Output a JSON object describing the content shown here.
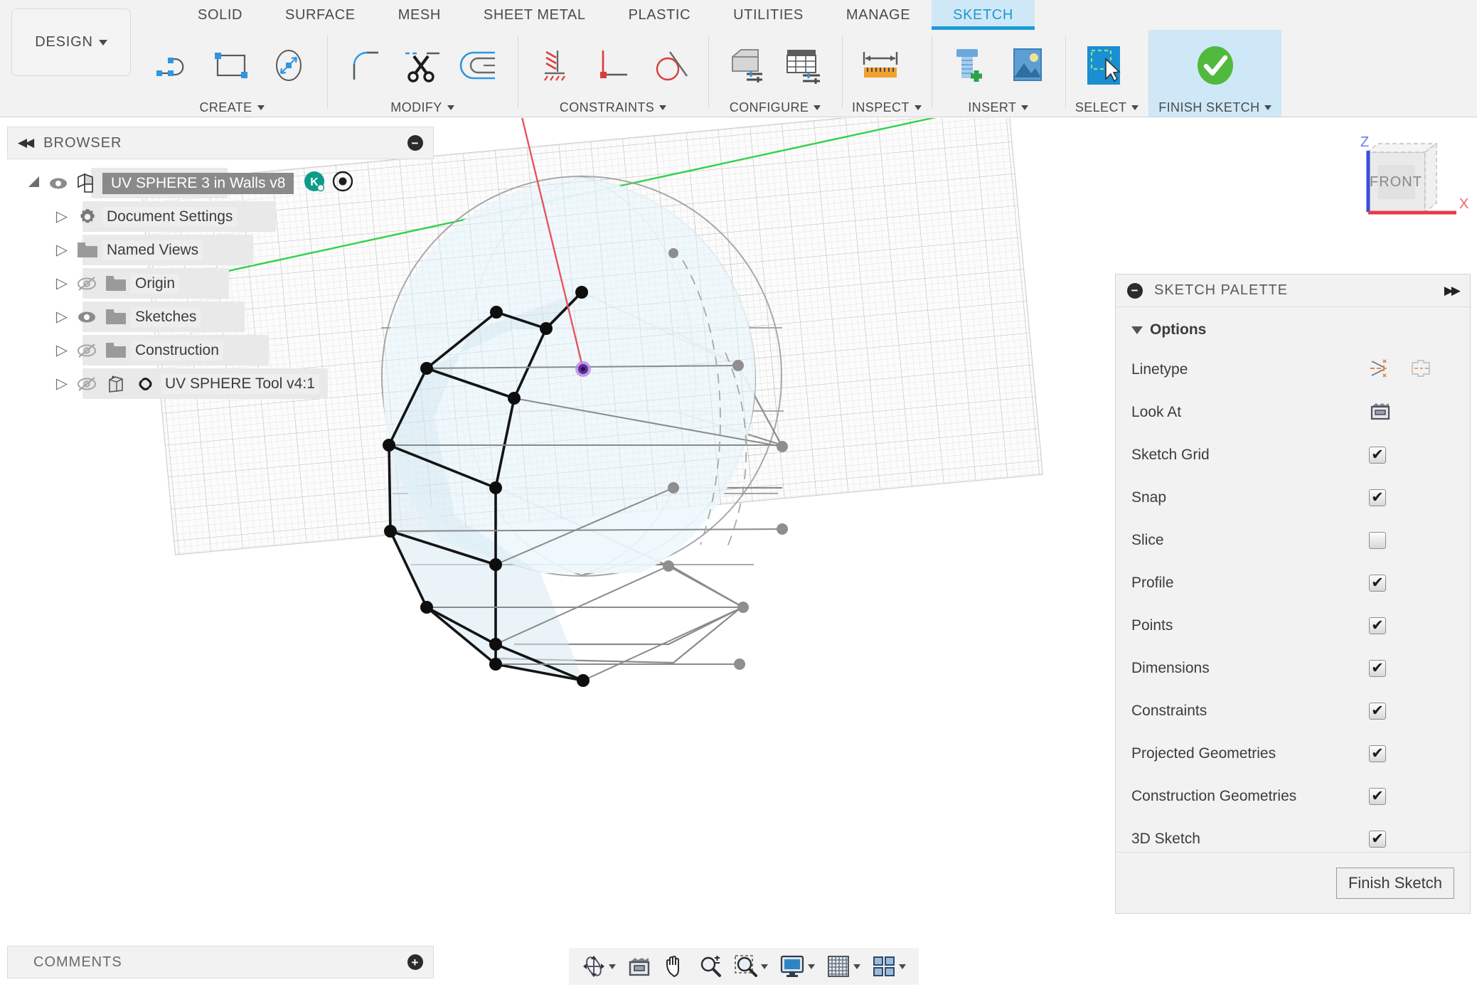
{
  "app": {
    "workspace_button": "DESIGN",
    "tabs": [
      {
        "label": "SOLID",
        "active": false
      },
      {
        "label": "SURFACE",
        "active": false
      },
      {
        "label": "MESH",
        "active": false
      },
      {
        "label": "SHEET METAL",
        "active": false
      },
      {
        "label": "PLASTIC",
        "active": false
      },
      {
        "label": "UTILITIES",
        "active": false
      },
      {
        "label": "MANAGE",
        "active": false
      },
      {
        "label": "SKETCH",
        "active": true
      }
    ],
    "ribbon_panels": [
      {
        "title": "CREATE",
        "has_dropdown": true,
        "icons": [
          "line-arc-icon",
          "rectangle-icon",
          "circle-diameter-icon"
        ]
      },
      {
        "title": "MODIFY",
        "has_dropdown": true,
        "icons": [
          "fillet-icon",
          "trim-scissors-icon",
          "offset-icon"
        ]
      },
      {
        "title": "CONSTRAINTS",
        "has_dropdown": true,
        "icons": [
          "fix-ground-icon",
          "perpendicular-icon",
          "tangent-icon"
        ]
      },
      {
        "title": "CONFIGURE",
        "has_dropdown": true,
        "icons": [
          "configure-part-icon",
          "configure-table-icon"
        ]
      },
      {
        "title": "INSPECT",
        "has_dropdown": true,
        "icons": [
          "measure-ruler-icon"
        ]
      },
      {
        "title": "INSERT",
        "has_dropdown": true,
        "icons": [
          "insert-mcmaster-bolt-icon",
          "insert-canvas-image-icon"
        ]
      },
      {
        "title": "SELECT",
        "has_dropdown": true,
        "icons": [
          "select-window-cursor-icon"
        ]
      },
      {
        "title": "FINISH SKETCH",
        "has_dropdown": true,
        "icons": [
          "green-check-icon"
        ],
        "highlight": true
      }
    ]
  },
  "browser": {
    "title": "BROWSER",
    "collapse_icon": "collapse-left-icon",
    "minimize_icon": "minus-circle-icon",
    "tree": [
      {
        "label": "UV SPHERE 3 in Walls v8",
        "selected": true,
        "indent": 0,
        "arrow": "expanded",
        "eye": "visible",
        "icon": "document-cube-icon",
        "badges": [
          "owner-avatar-K",
          "target-circle-icon"
        ]
      },
      {
        "label": "Document Settings",
        "selected": false,
        "indent": 1,
        "arrow": "collapsed",
        "eye": "none",
        "icon": "gear-icon"
      },
      {
        "label": "Named Views",
        "selected": false,
        "indent": 1,
        "arrow": "collapsed",
        "eye": "none",
        "icon": "folder-icon"
      },
      {
        "label": "Origin",
        "selected": false,
        "indent": 1,
        "arrow": "collapsed",
        "eye": "hidden",
        "icon": "folder-icon"
      },
      {
        "label": "Sketches",
        "selected": false,
        "indent": 1,
        "arrow": "collapsed",
        "eye": "visible",
        "icon": "folder-icon"
      },
      {
        "label": "Construction",
        "selected": false,
        "indent": 1,
        "arrow": "collapsed",
        "eye": "hidden",
        "icon": "folder-icon"
      },
      {
        "label": "UV SPHERE Tool v4:1",
        "selected": false,
        "indent": 1,
        "arrow": "collapsed",
        "eye": "hidden",
        "icon": "component-icon",
        "extra_icon": "link-chain-icon"
      }
    ]
  },
  "comments": {
    "title": "COMMENTS",
    "add_icon": "plus-circle-icon"
  },
  "sketch_palette": {
    "title": "SKETCH PALETTE",
    "minimize_icon": "minus-circle-icon",
    "expand_icon": "double-chevron-right-icon",
    "section": "Options",
    "options": [
      {
        "label": "Linetype",
        "type": "icons",
        "icons": [
          "construction-linetype-icon",
          "centerline-linetype-icon"
        ]
      },
      {
        "label": "Look At",
        "type": "icon",
        "icons": [
          "look-at-camera-icon"
        ]
      },
      {
        "label": "Sketch Grid",
        "type": "checkbox",
        "checked": true
      },
      {
        "label": "Snap",
        "type": "checkbox",
        "checked": true
      },
      {
        "label": "Slice",
        "type": "checkbox",
        "checked": false
      },
      {
        "label": "Profile",
        "type": "checkbox",
        "checked": true
      },
      {
        "label": "Points",
        "type": "checkbox",
        "checked": true
      },
      {
        "label": "Dimensions",
        "type": "checkbox",
        "checked": true
      },
      {
        "label": "Constraints",
        "type": "checkbox",
        "checked": true
      },
      {
        "label": "Projected Geometries",
        "type": "checkbox",
        "checked": true
      },
      {
        "label": "Construction Geometries",
        "type": "checkbox",
        "checked": true
      },
      {
        "label": "3D Sketch",
        "type": "checkbox",
        "checked": true
      }
    ],
    "finish_button": "Finish Sketch"
  },
  "viewcube": {
    "face_label": "FRONT",
    "axis_z": "Z",
    "axis_x": "X",
    "z_color": "#3b4fd8",
    "x_color": "#e8394a"
  },
  "navbar": {
    "items": [
      {
        "name": "orbit-icon",
        "dropdown": true
      },
      {
        "name": "look-at-icon",
        "dropdown": false
      },
      {
        "name": "pan-hand-icon",
        "dropdown": false
      },
      {
        "name": "zoom-icon",
        "dropdown": false
      },
      {
        "name": "zoom-window-icon",
        "dropdown": true
      },
      {
        "name": "display-settings-icon",
        "dropdown": true
      },
      {
        "name": "grid-snaps-icon",
        "dropdown": true
      },
      {
        "name": "viewports-icon",
        "dropdown": true
      }
    ]
  },
  "viewport": {
    "sketch_plane_fill": "#fbfbfb",
    "sketch_grid_color": "#cfcfcf",
    "axis_green_color": "#2fd24a",
    "axis_red_color": "#e8545f",
    "sphere_fill": "#dcecf5",
    "sphere_fill_lower": "#eef7fc",
    "center_point_color": "#7a3fc9",
    "selected_edge_color": "#111111",
    "background": "#ffffff"
  }
}
